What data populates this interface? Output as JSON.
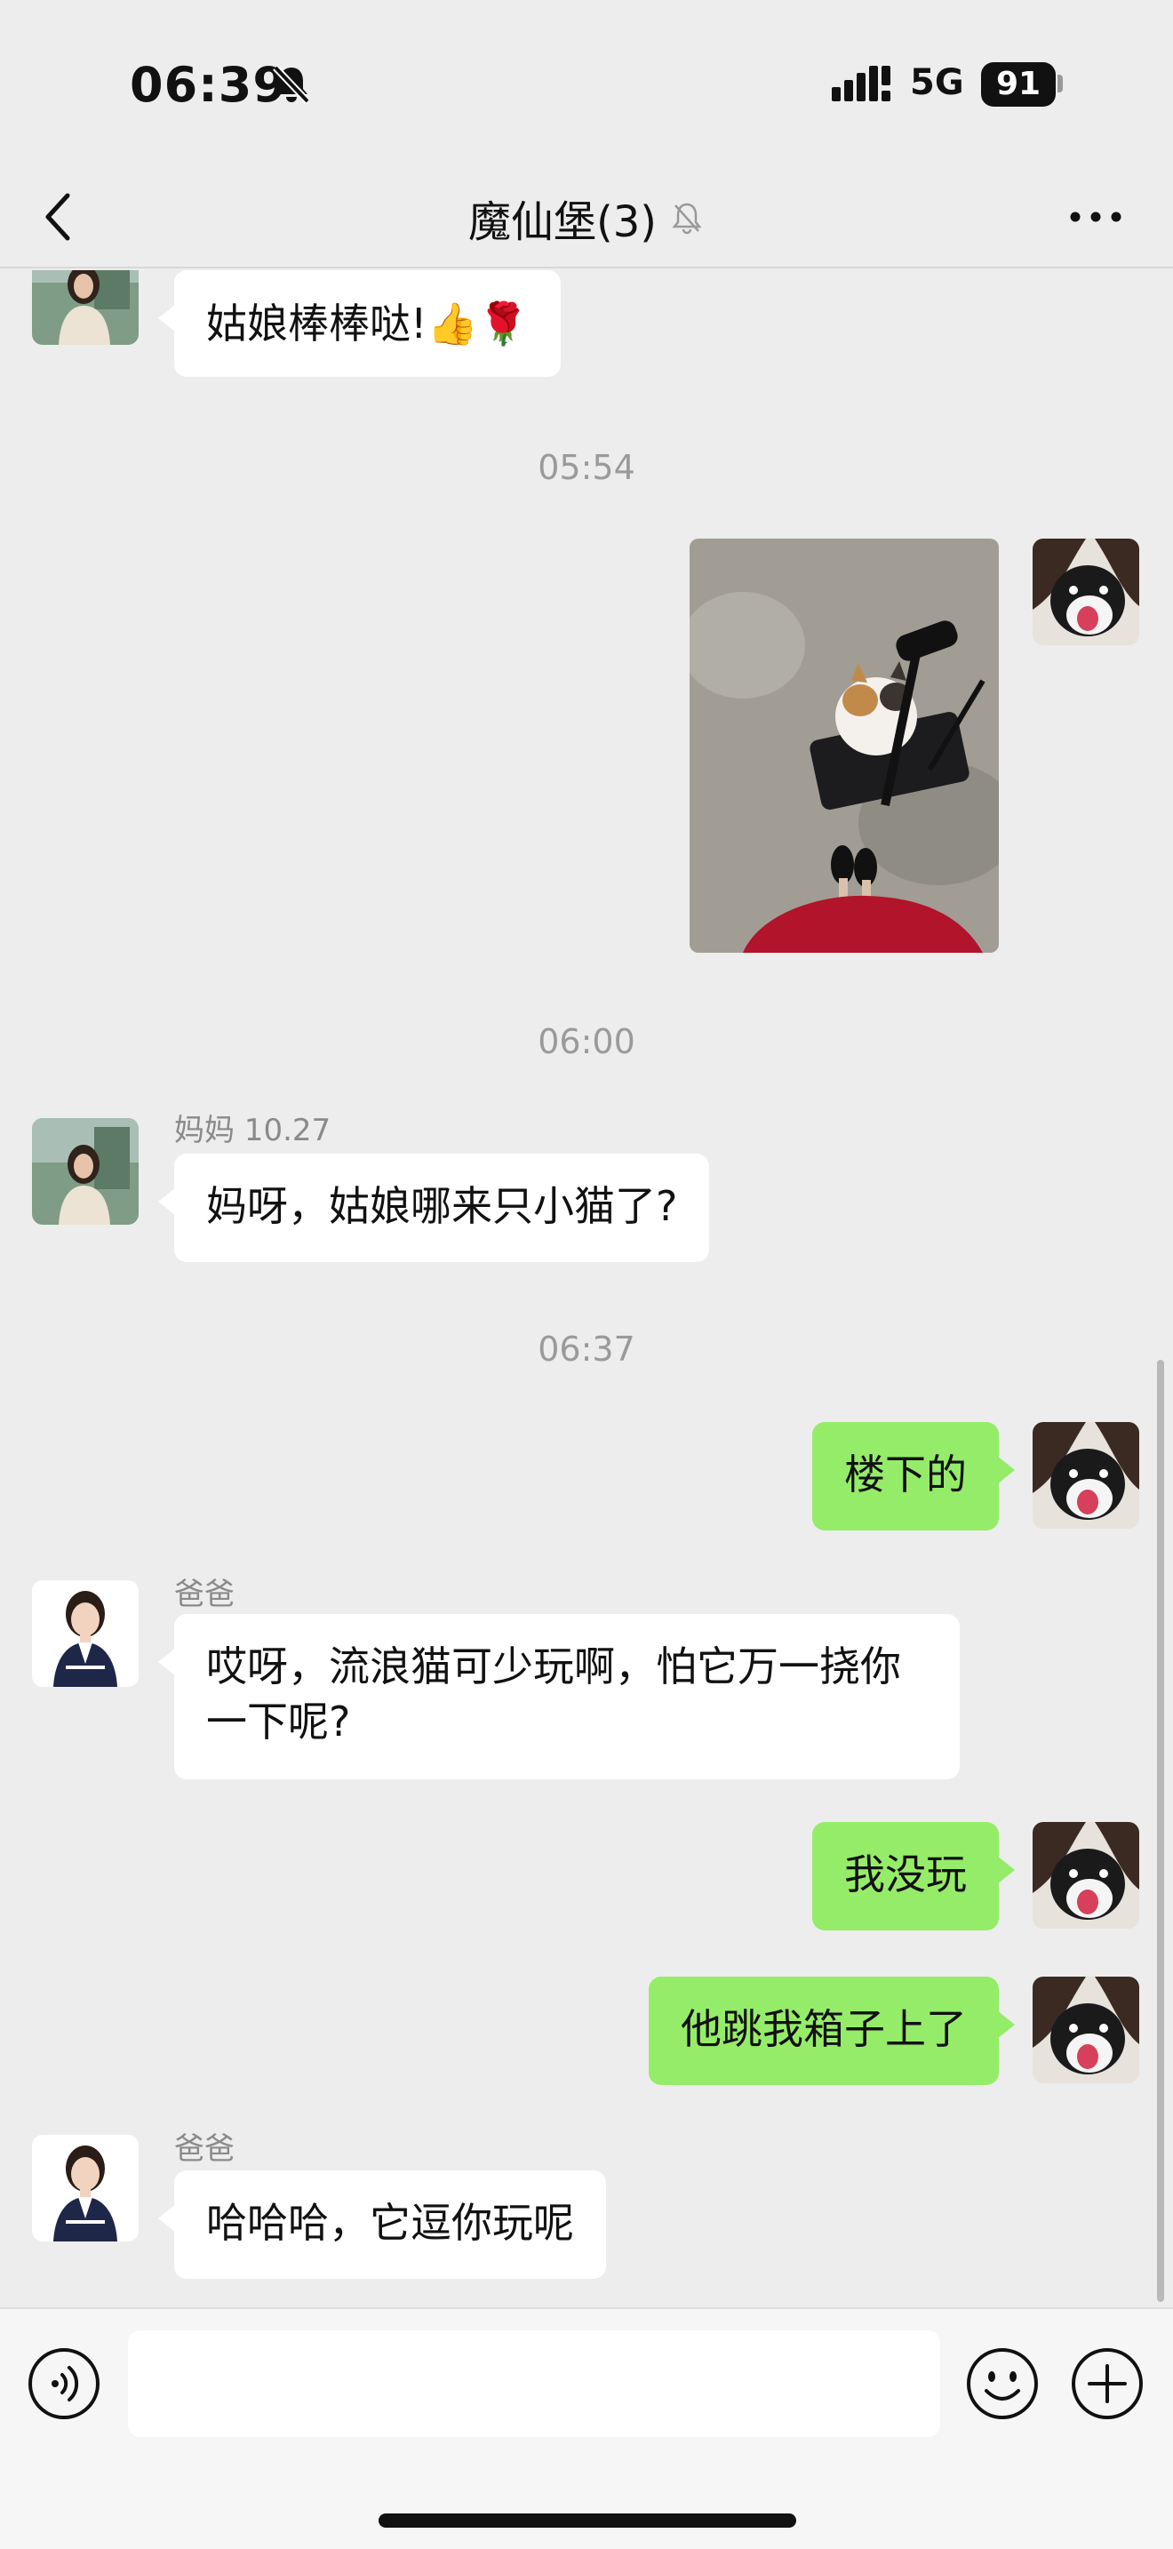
{
  "status_bar": {
    "time": "06:39",
    "network": "5G",
    "battery": "91"
  },
  "nav": {
    "title": "魔仙堡(3)"
  },
  "messages": {
    "m1": {
      "text": "姑娘棒棒哒!👍🌹"
    },
    "t1": "05:54",
    "t2": "06:00",
    "m3": {
      "sender": "妈妈 10.27",
      "text": "妈呀，姑娘哪来只小猫了?"
    },
    "t3": "06:37",
    "m4": {
      "text": "楼下的"
    },
    "m5": {
      "sender": "爸爸",
      "text": "哎呀，流浪猫可少玩啊，怕它万一挠你一下呢?"
    },
    "m6": {
      "text": "我没玩"
    },
    "m7": {
      "text": "他跳我箱子上了"
    },
    "m8": {
      "sender": "爸爸",
      "text": "哈哈哈，它逗你玩呢"
    }
  },
  "icons": {
    "back": "chevron-left-icon",
    "mute": "bell-off-icon",
    "more": "more-icon",
    "voice": "voice-icon",
    "emoji": "emoji-icon",
    "plus": "plus-icon"
  },
  "colors": {
    "background": "#ededed",
    "self_bubble": "#95ec69",
    "other_bubble": "#ffffff"
  }
}
